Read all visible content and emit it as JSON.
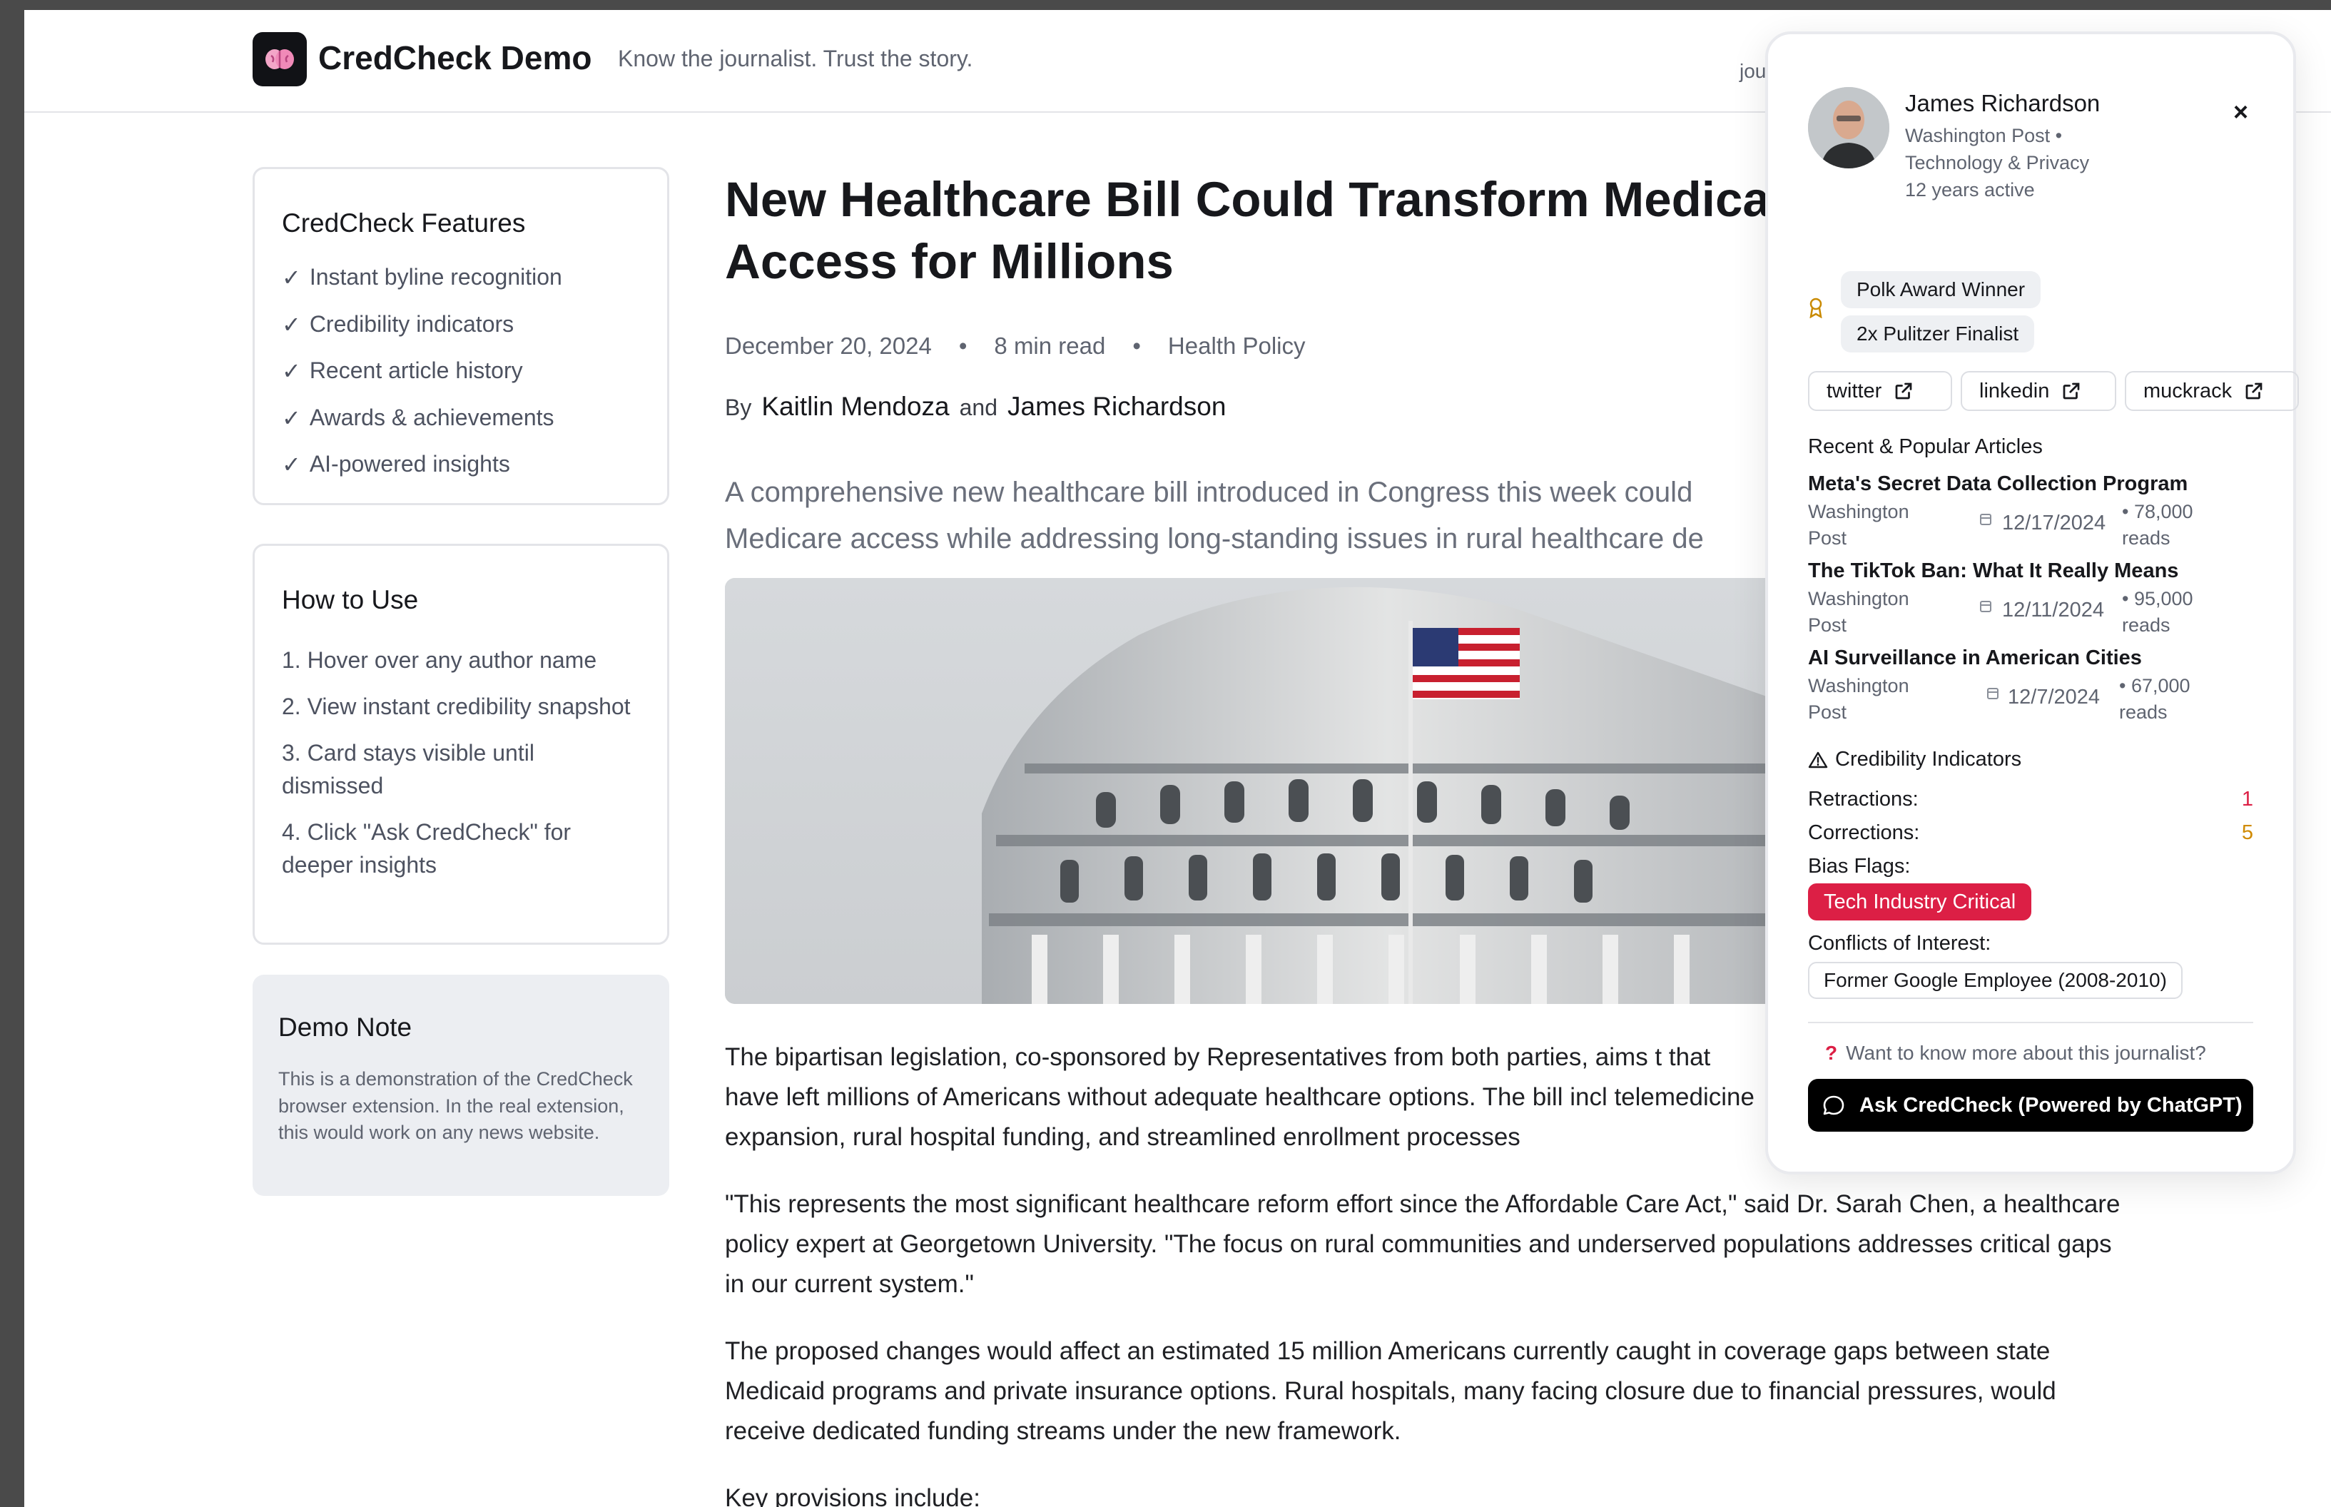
{
  "header": {
    "brand": "CredCheck Demo",
    "tagline": "Know the journalist. Trust the story.",
    "right_partial": "jou"
  },
  "sidebar": {
    "features": {
      "title": "CredCheck Features",
      "items": [
        "Instant byline recognition",
        "Credibility indicators",
        "Recent article history",
        "Awards & achievements",
        "AI-powered insights"
      ],
      "check": "✓"
    },
    "how_to": {
      "title": "How to Use",
      "steps": [
        "1. Hover over any author name",
        "2. View instant credibility snapshot",
        "3. Card stays visible until dismissed",
        "4. Click \"Ask CredCheck\" for deeper insights"
      ]
    },
    "demo_note": {
      "title": "Demo Note",
      "text": "This is a demonstration of the CredCheck browser extension. In the real extension, this would work on any news website."
    }
  },
  "article": {
    "title": "New Healthcare Bill Could Transform Medicare Access for Millions",
    "date": "December 20, 2024",
    "read_time": "8 min read",
    "category": "Health Policy",
    "dot": "•",
    "by": "By",
    "and": "and",
    "author_1": "Kaitlin Mendoza",
    "author_2": "James Richardson",
    "lede_1": "A comprehensive new healthcare bill introduced in Congress this week could",
    "lede_2": "Medicare access while addressing long-standing issues in rural healthcare de",
    "p1": "The bipartisan legislation, co-sponsored by Representatives from both parties, aims t that have left millions of Americans without adequate healthcare options. The bill incl telemedicine expansion, rural hospital funding, and streamlined enrollment processes",
    "p2": "\"This represents the most significant healthcare reform effort since the Affordable Care Act,\" said Dr. Sarah Chen, a healthcare policy expert at Georgetown University. \"The focus on rural communities and underserved populations addresses critical gaps in our current system.\"",
    "p3": "The proposed changes would affect an estimated 15 million Americans currently caught in coverage gaps between state Medicaid programs and private insurance options. Rural hospitals, many facing closure due to financial pressures, would receive dedicated funding streams under the new framework.",
    "p4": "Key provisions include:"
  },
  "popover": {
    "name": "James Richardson",
    "outlet": "Washington Post •",
    "beat": "Technology & Privacy",
    "years": "12 years active",
    "close": "×",
    "awards": [
      "Polk Award Winner",
      "2x Pulitzer Finalist"
    ],
    "social": [
      "twitter",
      "linkedin",
      "muckrack"
    ],
    "recent_title": "Recent & Popular Articles",
    "articles": [
      {
        "title": "Meta's Secret Data Collection Program",
        "pub_1": "Washington",
        "pub_2": "Post",
        "date": "12/17/2024",
        "reads_1": "• 78,000",
        "reads_2": "reads"
      },
      {
        "title": "The TikTok Ban: What It Really Means",
        "pub_1": "Washington",
        "pub_2": "Post",
        "date": "12/11/2024",
        "reads_1": "• 95,000",
        "reads_2": "reads"
      },
      {
        "title": "AI Surveillance in American Cities",
        "pub_1": "Washington",
        "pub_2": "Post",
        "date": "12/7/2024",
        "reads_1": "• 67,000",
        "reads_2": "reads"
      }
    ],
    "cred_title": "Credibility Indicators",
    "retractions_label": "Retractions:",
    "retractions": "1",
    "corrections_label": "Corrections:",
    "corrections": "5",
    "bias_label": "Bias Flags:",
    "bias": "Tech Industry Critical",
    "coi_label": "Conflicts of Interest:",
    "coi": "Former Google Employee (2008-2010)",
    "want_q": "?",
    "want": "Want to know more about this journalist?",
    "ask": "Ask CredCheck (Powered by ChatGPT)"
  },
  "colors": {
    "accent_red": "#dc1f45",
    "corrections": "#d08a00",
    "retractions": "#dc1f45",
    "award_icon": "#c98a00"
  }
}
